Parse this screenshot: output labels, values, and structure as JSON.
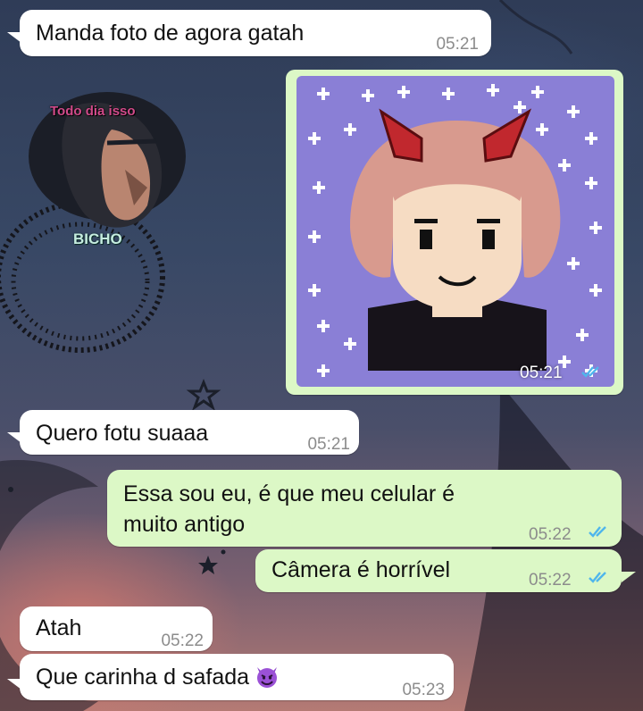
{
  "sticker": {
    "top_text": "Todo dia isso",
    "bottom_text": "BICHO"
  },
  "messages": [
    {
      "text": "Manda foto de agora gatah",
      "time": "05:21"
    },
    {
      "time": "05:21"
    },
    {
      "text": "Quero fotu suaaa",
      "time": "05:21"
    },
    {
      "line1": "Essa sou eu, é que meu celular é",
      "line2": "muito antigo",
      "time": "05:22"
    },
    {
      "text": "Câmera é horrível",
      "time": "05:22"
    },
    {
      "text": "Atah",
      "time": "05:22"
    },
    {
      "text": "Que carinha d safada",
      "time": "05:23"
    }
  ],
  "icons": {
    "read_receipt": "double-check-icon",
    "emoji": "smiling-imp-emoji"
  },
  "colors": {
    "incoming_bubble": "#ffffff",
    "outgoing_bubble": "#dcf8c6",
    "read_tick": "#4fb6ec",
    "avatar_background": "#8a7fd6"
  }
}
